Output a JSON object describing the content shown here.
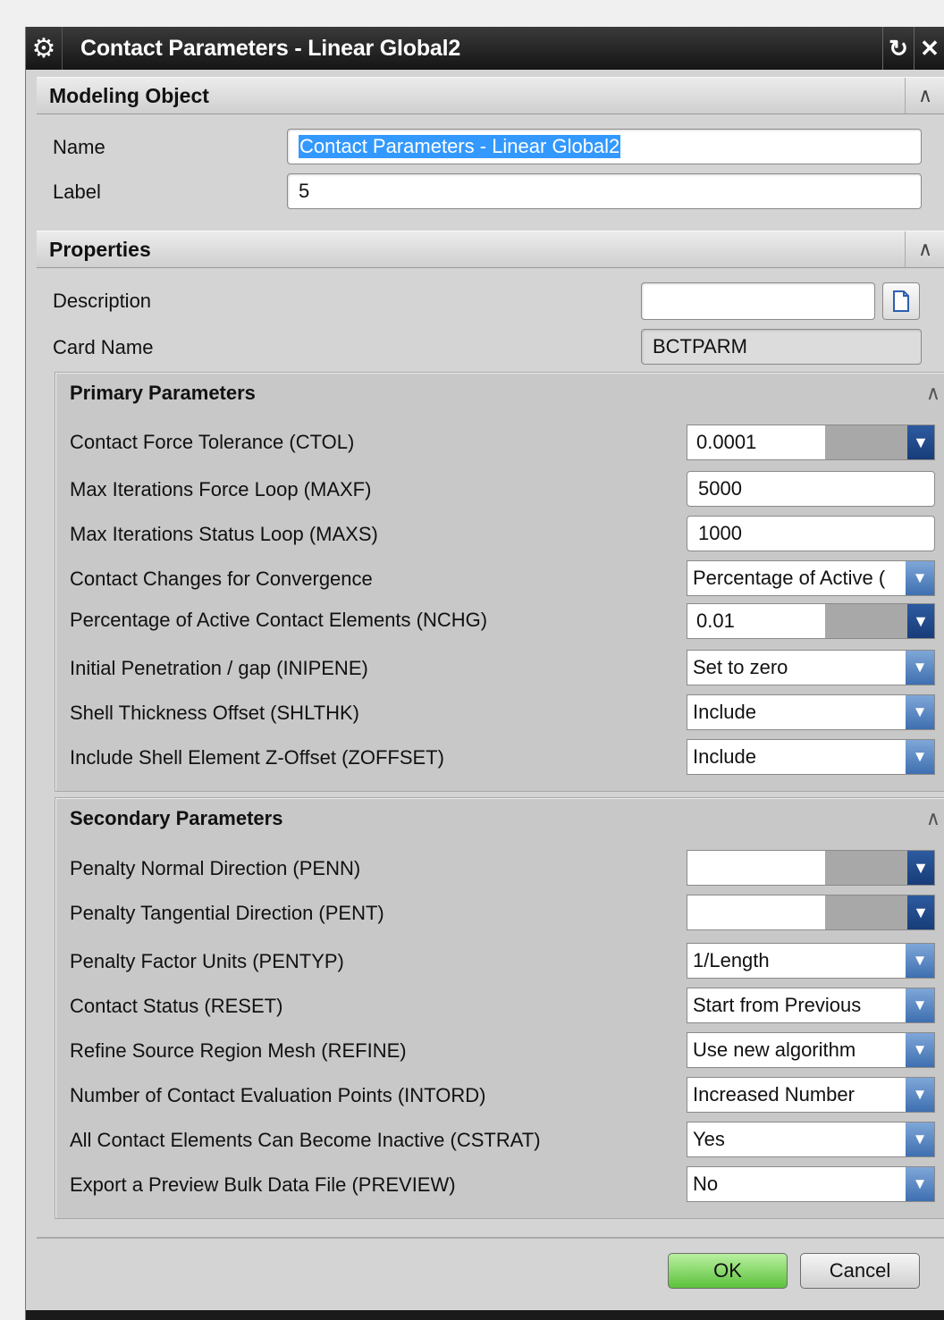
{
  "title": "Contact Parameters - Linear Global2",
  "icons": {
    "gear": "⚙",
    "reset": "↻",
    "close": "✕",
    "collapse": "∧",
    "down": "▼",
    "doc": "document-icon"
  },
  "modeling_object": {
    "header": "Modeling Object",
    "name_label": "Name",
    "name_value": "Contact Parameters - Linear Global2",
    "label_label": "Label",
    "label_value": "5"
  },
  "properties": {
    "header": "Properties",
    "description_label": "Description",
    "description_value": "",
    "card_name_label": "Card Name",
    "card_name_value": "BCTPARM"
  },
  "primary": {
    "header": "Primary Parameters",
    "rows": [
      {
        "label": "Contact Force Tolerance (CTOL)",
        "value": "0.0001",
        "kind": "expr"
      },
      {
        "label": "Max Iterations Force Loop (MAXF)",
        "value": "5000",
        "kind": "entry"
      },
      {
        "label": "Max Iterations Status Loop (MAXS)",
        "value": "1000",
        "kind": "entry"
      },
      {
        "label": "Contact Changes for Convergence",
        "value": "Percentage of Active (",
        "kind": "combo"
      },
      {
        "label": "Percentage of Active Contact Elements (NCHG)",
        "value": "0.01",
        "kind": "expr"
      },
      {
        "label": "Initial Penetration / gap (INIPENE)",
        "value": "Set to zero",
        "kind": "combo"
      },
      {
        "label": "Shell Thickness Offset (SHLTHK)",
        "value": "Include",
        "kind": "combo"
      },
      {
        "label": "Include Shell Element Z-Offset (ZOFFSET)",
        "value": "Include",
        "kind": "combo"
      }
    ]
  },
  "secondary": {
    "header": "Secondary Parameters",
    "rows": [
      {
        "label": "Penalty Normal Direction (PENN)",
        "value": "",
        "kind": "expr"
      },
      {
        "label": "Penalty Tangential Direction (PENT)",
        "value": "",
        "kind": "expr"
      },
      {
        "label": "Penalty Factor Units (PENTYP)",
        "value": "1/Length",
        "kind": "combo"
      },
      {
        "label": "Contact Status (RESET)",
        "value": "Start from Previous",
        "kind": "combo"
      },
      {
        "label": "Refine Source Region Mesh (REFINE)",
        "value": "Use new algorithm",
        "kind": "combo"
      },
      {
        "label": "Number of Contact Evaluation Points (INTORD)",
        "value": "Increased Number",
        "kind": "combo"
      },
      {
        "label": "All Contact Elements Can Become Inactive (CSTRAT)",
        "value": "Yes",
        "kind": "combo"
      },
      {
        "label": "Export a Preview Bulk Data File (PREVIEW)",
        "value": "No",
        "kind": "combo"
      }
    ]
  },
  "buttons": {
    "ok": "OK",
    "cancel": "Cancel"
  }
}
